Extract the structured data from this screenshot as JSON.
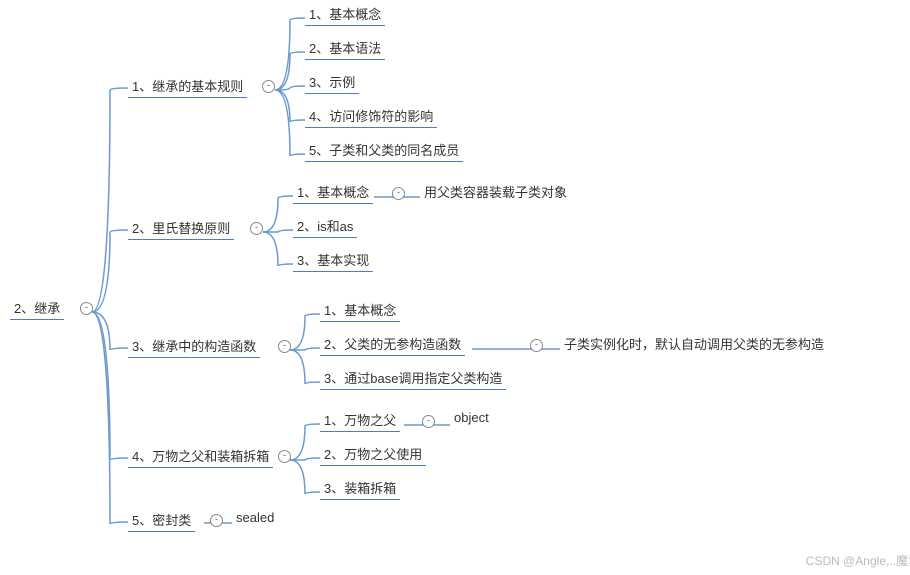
{
  "root": {
    "label": "2、继承"
  },
  "branches": [
    {
      "label": "1、继承的基本规则",
      "children": [
        {
          "label": "1、基本概念"
        },
        {
          "label": "2、基本语法"
        },
        {
          "label": "3、示例"
        },
        {
          "label": "4、访问修饰符的影响"
        },
        {
          "label": "5、子类和父类的同名成员"
        }
      ]
    },
    {
      "label": "2、里氏替换原则",
      "children": [
        {
          "label": "1、基本概念",
          "note": "用父类容器装载子类对象"
        },
        {
          "label": "2、is和as"
        },
        {
          "label": "3、基本实现"
        }
      ]
    },
    {
      "label": "3、继承中的构造函数",
      "children": [
        {
          "label": "1、基本概念"
        },
        {
          "label": "2、父类的无参构造函数",
          "note": "子类实例化时，默认自动调用父类的无参构造"
        },
        {
          "label": "3、通过base调用指定父类构造"
        }
      ]
    },
    {
      "label": "4、万物之父和装箱拆箱",
      "children": [
        {
          "label": "1、万物之父",
          "note": "object"
        },
        {
          "label": "2、万物之父使用"
        },
        {
          "label": "3、装箱拆箱"
        }
      ]
    },
    {
      "label": "5、密封类",
      "note": "sealed"
    }
  ],
  "watermark": "CSDN @Angle,..魔君"
}
